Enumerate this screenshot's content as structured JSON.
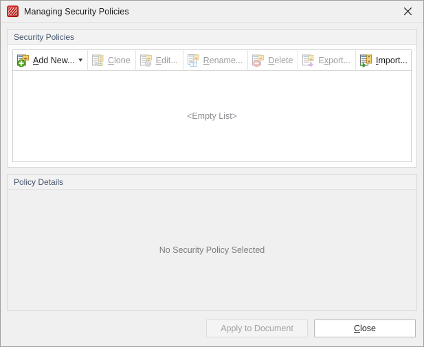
{
  "window": {
    "title": "Managing Security Policies",
    "icon": "pdf-xchange-icon",
    "close_icon": "close-icon"
  },
  "policies_group": {
    "header": "Security Policies",
    "empty_text": "<Empty List>",
    "toolbar": [
      {
        "id": "add-new",
        "label": "Add New...",
        "accel": "A",
        "icon": "add-policy-icon",
        "enabled": true,
        "has_dropdown": true,
        "caret": "⌄"
      },
      {
        "id": "clone",
        "label": "Clone",
        "accel": "C",
        "icon": "clone-policy-icon",
        "enabled": false,
        "has_dropdown": false
      },
      {
        "id": "edit",
        "label": "Edit...",
        "accel": "E",
        "icon": "edit-policy-icon",
        "enabled": false,
        "has_dropdown": false
      },
      {
        "id": "rename",
        "label": "Rename...",
        "accel": "R",
        "icon": "rename-policy-icon",
        "enabled": false,
        "has_dropdown": false
      },
      {
        "id": "delete",
        "label": "Delete",
        "accel": "D",
        "icon": "delete-policy-icon",
        "enabled": false,
        "has_dropdown": false
      },
      {
        "id": "export",
        "label": "Export...",
        "accel": "x",
        "icon": "export-policy-icon",
        "enabled": false,
        "has_dropdown": false
      },
      {
        "id": "import",
        "label": "Import...",
        "accel": "I",
        "icon": "import-policy-icon",
        "enabled": true,
        "has_dropdown": false
      }
    ]
  },
  "details_group": {
    "header": "Policy Details",
    "placeholder": "No Security Policy Selected"
  },
  "footer": {
    "apply_label": "Apply to Document",
    "apply_enabled": false,
    "close_label": "Close",
    "close_accel": "C",
    "close_enabled": true
  },
  "colors": {
    "dialog_bg": "#f0f0f0",
    "group_header_text": "#43536b",
    "list_bg": "#ffffff",
    "placeholder_text": "#8f8f94",
    "accent_red": "#c0211c",
    "accent_green": "#5aa832",
    "accent_yellow": "#f2c14a"
  }
}
